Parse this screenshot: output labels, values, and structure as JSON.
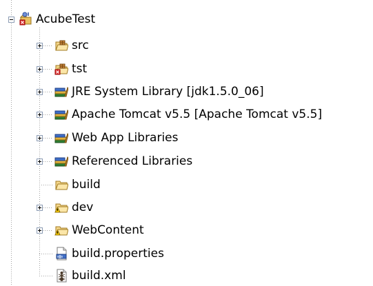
{
  "tree": {
    "root": {
      "label": "AcubeTest",
      "icon": "java-project-error-icon",
      "expanded": true
    },
    "children": [
      {
        "id": "src",
        "label": "src",
        "icon": "package-folder-icon",
        "toggle": "plus"
      },
      {
        "id": "tst",
        "label": "tst",
        "icon": "package-folder-error-icon",
        "toggle": "plus"
      },
      {
        "id": "jre",
        "label": "JRE System Library [jdk1.5.0_06]",
        "icon": "library-icon",
        "toggle": "plus"
      },
      {
        "id": "tomcat",
        "label": "Apache Tomcat v5.5 [Apache Tomcat v5.5]",
        "icon": "library-icon",
        "toggle": "plus"
      },
      {
        "id": "webapp",
        "label": "Web App Libraries",
        "icon": "library-icon",
        "toggle": "plus"
      },
      {
        "id": "reflibs",
        "label": "Referenced Libraries",
        "icon": "library-icon",
        "toggle": "plus"
      },
      {
        "id": "build",
        "label": "build",
        "icon": "folder-icon",
        "toggle": "none"
      },
      {
        "id": "dev",
        "label": "dev",
        "icon": "folder-warning-icon",
        "toggle": "plus"
      },
      {
        "id": "webcontent",
        "label": "WebContent",
        "icon": "folder-warning-icon",
        "toggle": "plus"
      },
      {
        "id": "buildprops",
        "label": "build.properties",
        "icon": "properties-file-icon",
        "toggle": "none"
      },
      {
        "id": "buildxml",
        "label": "build.xml",
        "icon": "ant-file-icon",
        "toggle": "none"
      }
    ]
  }
}
